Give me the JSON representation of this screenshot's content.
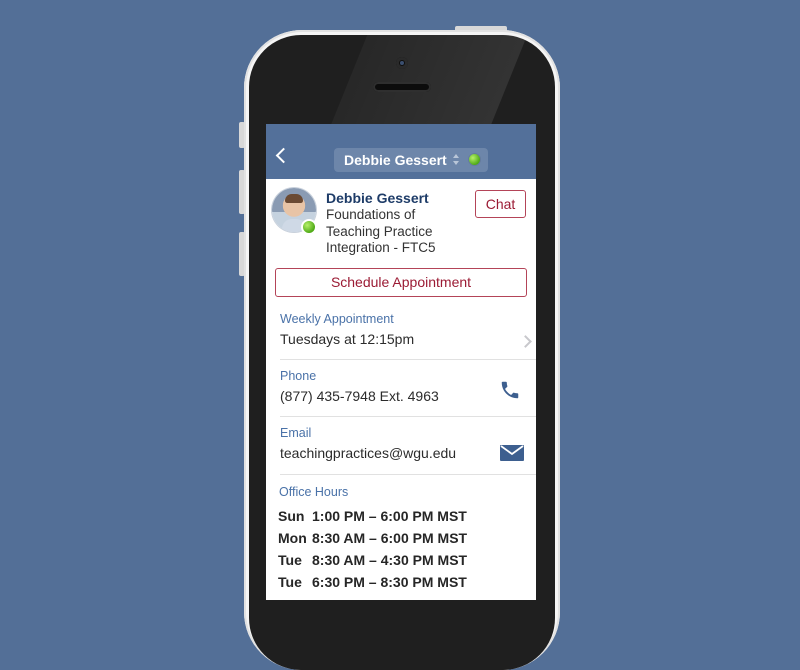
{
  "nav": {
    "title": "Debbie Gessert"
  },
  "profile": {
    "name": "Debbie Gessert",
    "course": "Foundations of Teaching Practice Integration - FTC5",
    "chat_label": "Chat",
    "online_status_color": "#5cbf1f"
  },
  "schedule_button_label": "Schedule Appointment",
  "weekly": {
    "label": "Weekly Appointment",
    "value": "Tuesdays at 12:15pm"
  },
  "phone": {
    "label": "Phone",
    "value": "(877) 435-7948 Ext. 4963",
    "icon": "phone-icon"
  },
  "email": {
    "label": "Email",
    "value": "teachingpractices@wgu.edu",
    "icon": "envelope-icon"
  },
  "office_hours": {
    "label": "Office Hours",
    "rows": [
      {
        "day": "Sun",
        "hours": "1:00 PM – 6:00 PM MST"
      },
      {
        "day": "Mon",
        "hours": "8:30 AM – 6:00 PM MST"
      },
      {
        "day": "Tue",
        "hours": "8:30 AM – 4:30 PM MST"
      },
      {
        "day": "Tue",
        "hours": "6:30 PM – 8:30 PM MST"
      }
    ]
  },
  "colors": {
    "background": "#536f97",
    "navbar": "#53709a",
    "accent_red": "#9b1b34",
    "label_blue": "#4a72a8",
    "name_blue": "#1e3c68"
  }
}
